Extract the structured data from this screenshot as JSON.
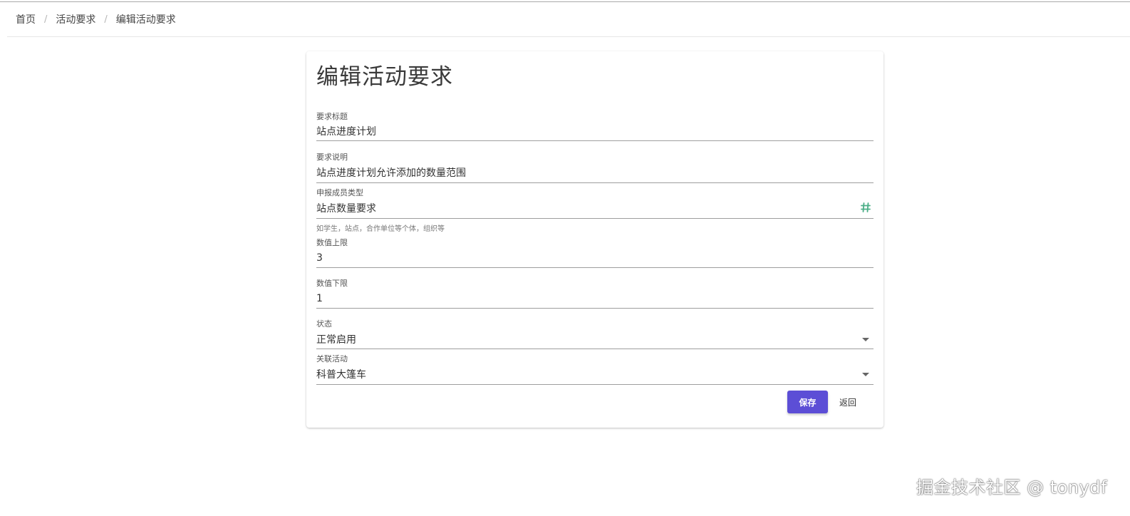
{
  "breadcrumb": {
    "items": [
      "首页",
      "活动要求",
      "编辑活动要求"
    ],
    "separator": "/"
  },
  "form": {
    "title": "编辑活动要求",
    "fields": {
      "req_title": {
        "label": "要求标题",
        "value": "站点进度计划"
      },
      "req_desc": {
        "label": "要求说明",
        "value": "站点进度计划允许添加的数量范围"
      },
      "member_type": {
        "label": "申报成员类型",
        "value": "站点数量要求",
        "hint": "如学生，站点，合作单位等个体，组织等",
        "icon": "hash-icon"
      },
      "max_value": {
        "label": "数值上限",
        "value": "3"
      },
      "min_value": {
        "label": "数值下限",
        "value": "1"
      },
      "status": {
        "label": "状态",
        "value": "正常启用",
        "icon": "chevron-down-icon"
      },
      "related_activity": {
        "label": "关联活动",
        "value": "科普大篷车",
        "icon": "chevron-down-icon"
      }
    },
    "save_label": "保存",
    "back_label": "返回"
  },
  "colors": {
    "primary": "#5c4ed6",
    "hash_icon": "#4caf88",
    "underline": "#9e9e9e"
  },
  "watermark": "掘金技术社区 @ tonydf"
}
